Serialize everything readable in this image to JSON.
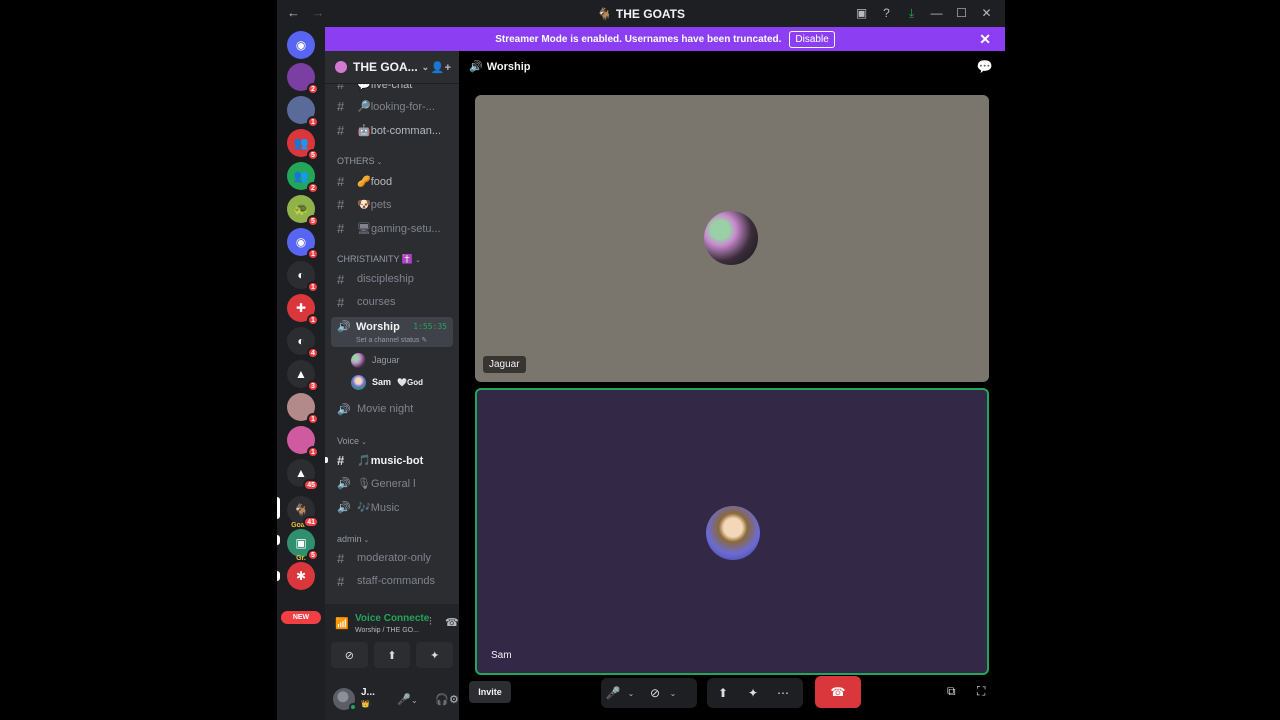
{
  "titlebar": {
    "back": "←",
    "forward": "→",
    "title_icon": "🐐",
    "title": "THE GOATS",
    "icons": [
      "inbox-icon",
      "help-icon",
      "download-icon",
      "minimize-icon",
      "maximize-icon",
      "close-icon"
    ]
  },
  "banner": {
    "text": "Streamer Mode is enabled. Usernames have been truncated.",
    "disable_label": "Disable",
    "close": "✕"
  },
  "rail": {
    "servers": [
      {
        "badge": ""
      },
      {
        "badge": "2"
      },
      {
        "badge": "1"
      },
      {
        "badge": "5"
      },
      {
        "badge": "2"
      },
      {
        "badge": "5"
      },
      {
        "badge": "1"
      },
      {
        "badge": "1"
      },
      {
        "badge": "1"
      },
      {
        "badge": "4"
      },
      {
        "badge": "3"
      },
      {
        "badge": "1"
      },
      {
        "badge": "1"
      },
      {
        "badge": "45"
      },
      {
        "badge": "41",
        "label": "Goats"
      },
      {
        "badge": "5",
        "label": "Gr."
      },
      {
        "badge": ""
      }
    ],
    "new_badge": "NEW"
  },
  "sidebar": {
    "guild_name": "THE GOA...",
    "channels_top": [
      {
        "name": "💬five-chat"
      },
      {
        "name": "🔎looking-for-..."
      },
      {
        "name": "🤖bot-comman..."
      }
    ],
    "cat_others": "OTHERS",
    "channels_others": [
      {
        "name": "🥜food"
      },
      {
        "name": "🐶pets"
      },
      {
        "name": "🖥gaming-setu..."
      }
    ],
    "cat_christianity": "CHRISTIANITY ✝️",
    "channels_christianity": [
      {
        "name": "discipleship"
      },
      {
        "name": "courses"
      }
    ],
    "worship": {
      "name": "Worship",
      "timer": "1:55:35",
      "status": "Set a channel status"
    },
    "voice_users": [
      {
        "name": "Jaguar"
      },
      {
        "name": "Sam",
        "extra": "🤍God"
      }
    ],
    "movie_night": "Movie night",
    "cat_voice": "Voice",
    "channels_voice": [
      {
        "name": "🎵music-bot"
      },
      {
        "name": "🎙General l"
      },
      {
        "name": "🎶Music"
      }
    ],
    "cat_admin": "admin",
    "channels_admin": [
      {
        "name": "moderator-only"
      },
      {
        "name": "staff-commands"
      }
    ]
  },
  "voice_panel": {
    "title": "Voice Connected",
    "subtitle": "Worship / THE GO...",
    "user_name": "J...",
    "user_sub": "👑·"
  },
  "main": {
    "channel": "Worship",
    "tiles": [
      {
        "name": "Jaguar"
      },
      {
        "name": "Sam"
      }
    ],
    "invite_label": "Invite"
  },
  "colors": {
    "banner": "#8c3ff2",
    "speaking": "#23a55a",
    "hangup": "#da373c",
    "tile1_bg": "#7a766e",
    "tile2_bg": "#342847"
  }
}
